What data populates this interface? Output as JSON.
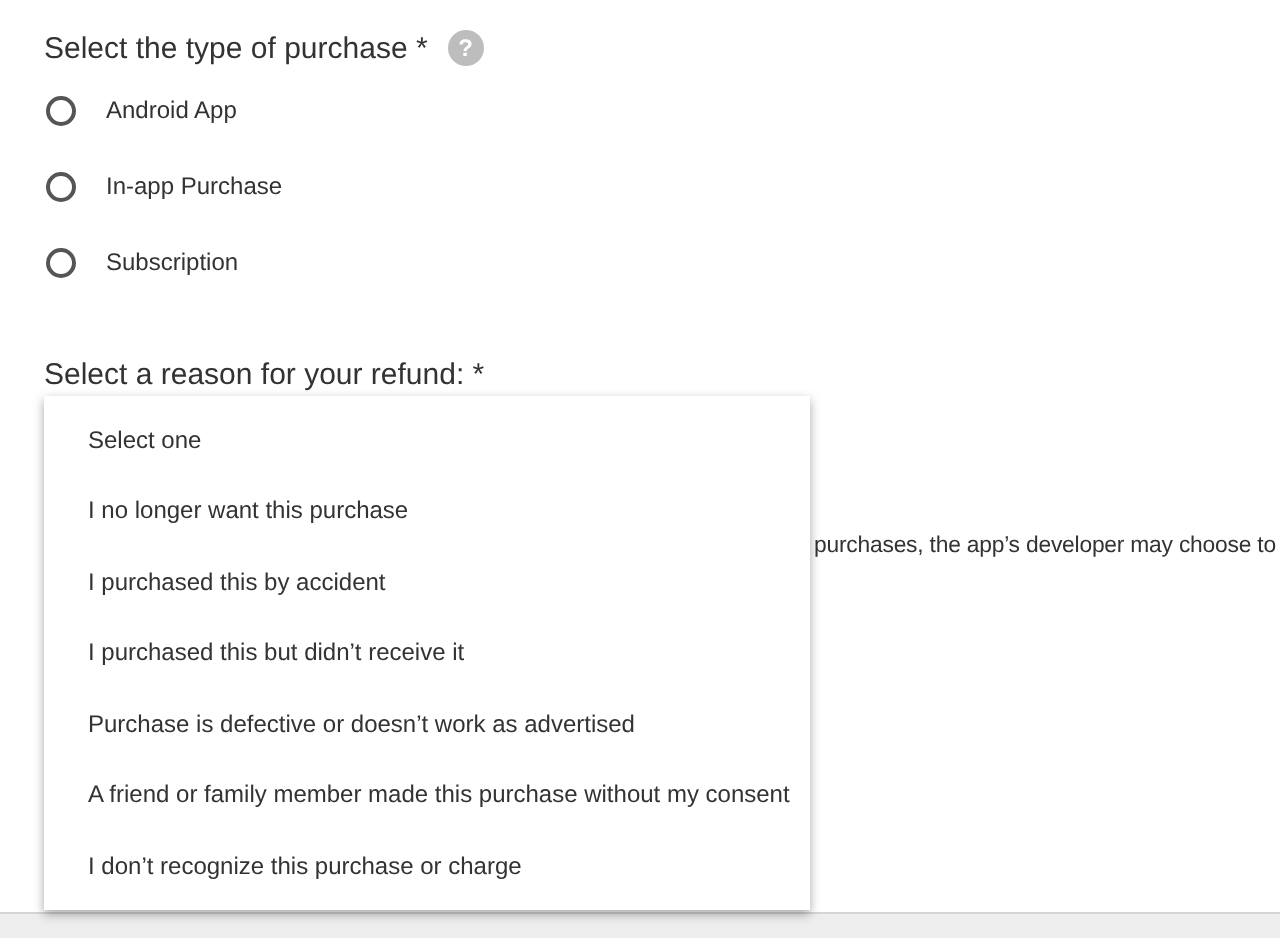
{
  "purchase_type": {
    "label": "Select the type of purchase *",
    "help_icon": "?",
    "options": [
      {
        "label": "Android App",
        "selected": false
      },
      {
        "label": "In-app Purchase",
        "selected": false
      },
      {
        "label": "Subscription",
        "selected": false
      }
    ]
  },
  "refund_reason": {
    "label": "Select a reason for your refund: *"
  },
  "background_text": "purchases, the app’s developer may choose to",
  "reason_menu": {
    "items": [
      "Select one",
      "I no longer want this purchase",
      "I purchased this by accident",
      "I purchased this but didn’t receive it",
      "Purchase is defective or doesn’t work as advertised",
      "A friend or family member made this purchase without my consent",
      "I don’t recognize this purchase or charge"
    ]
  }
}
